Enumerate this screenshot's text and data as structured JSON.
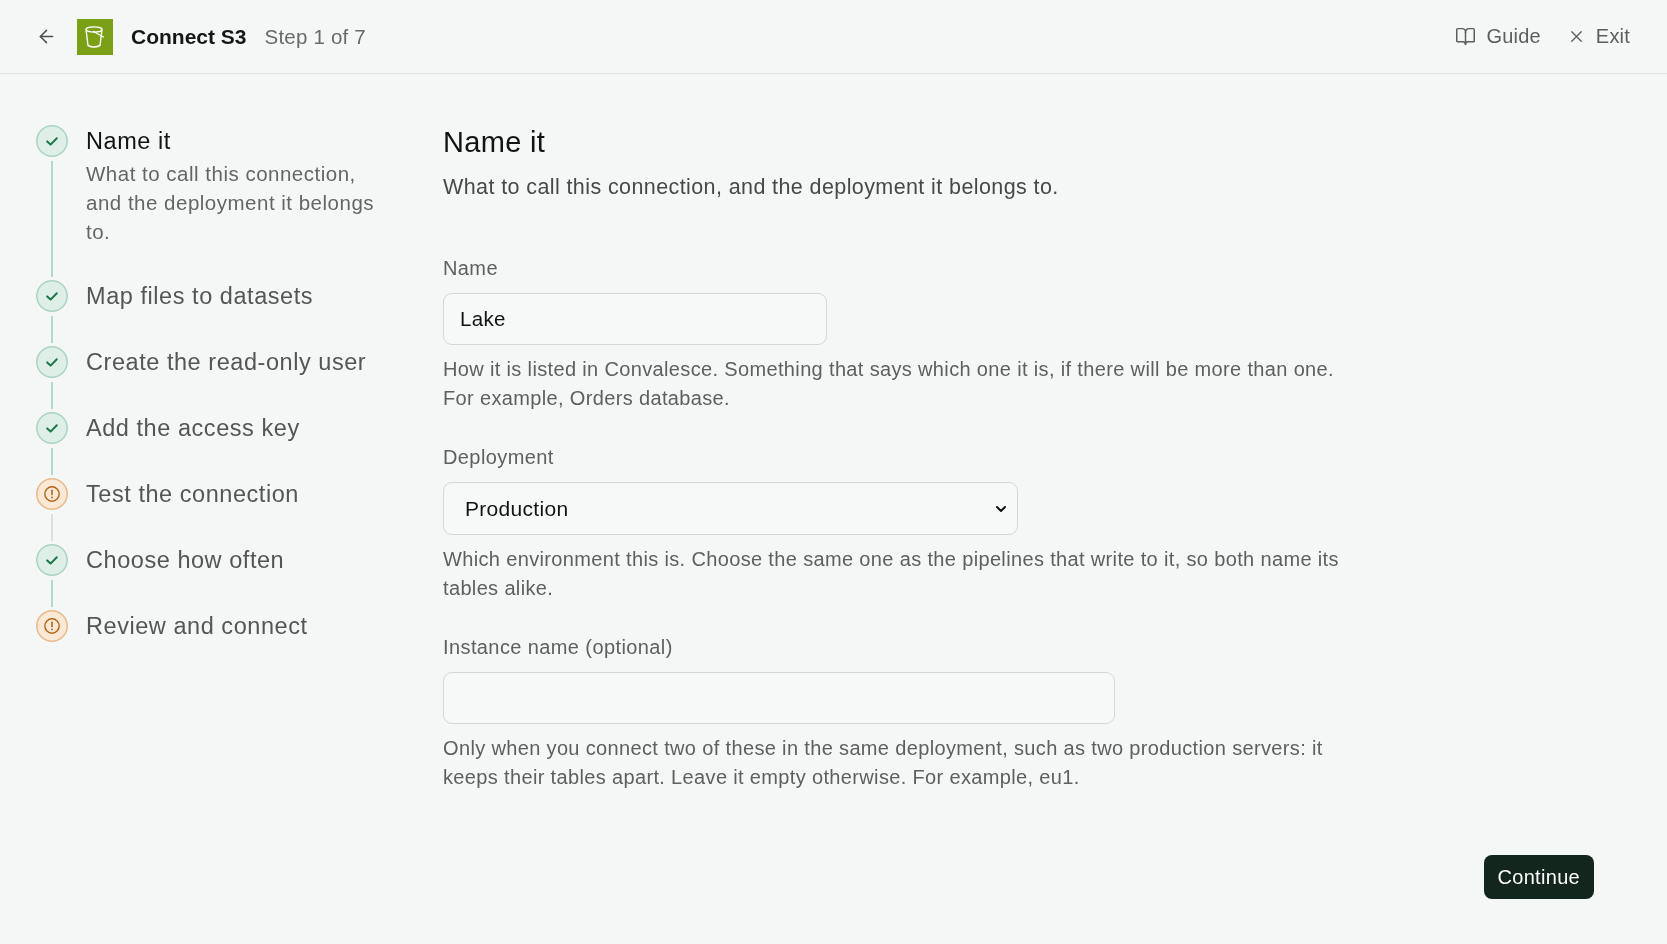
{
  "header": {
    "title": "Connect S3",
    "step": "Step 1 of 7",
    "actions": [
      {
        "kind": "guide",
        "label": "Guide"
      },
      {
        "kind": "exit",
        "label": "Exit"
      }
    ]
  },
  "steps": [
    {
      "title": "Name it",
      "description": "What to call this connection, and the deployment it belongs to.",
      "kind": "complete",
      "selected": true
    },
    {
      "title": "Map files to datasets",
      "kind": "complete",
      "selected": false
    },
    {
      "title": "Create the read-only user",
      "kind": "complete",
      "selected": false
    },
    {
      "title": "Add the access key",
      "kind": "complete",
      "selected": false
    },
    {
      "title": "Test the connection",
      "kind": "warning",
      "selected": false
    },
    {
      "title": "Choose how often",
      "kind": "complete",
      "selected": false
    },
    {
      "title": "Review and connect",
      "kind": "warning",
      "selected": false
    }
  ],
  "page": {
    "title": "Name it",
    "subtitle": "What to call this connection, and the deployment it belongs to."
  },
  "fields": [
    {
      "kind": "text",
      "label": "Name",
      "value": "Lake",
      "help": "How it is listed in Convalesce. Something that says which one it is, if there will be more than one. For example, Orders database."
    },
    {
      "kind": "select",
      "label": "Deployment",
      "value": "Production",
      "help": "Which environment this is. Choose the same one as the pipelines that write to it, so both name its tables alike."
    },
    {
      "kind": "text",
      "label": "Instance name (optional)",
      "help": "Only when you connect two of these in the same deployment, such as two production servers: it keeps their tables apart. Leave it empty otherwise. For example, eu1."
    }
  ],
  "continue_button": {
    "label": "Continue"
  }
}
